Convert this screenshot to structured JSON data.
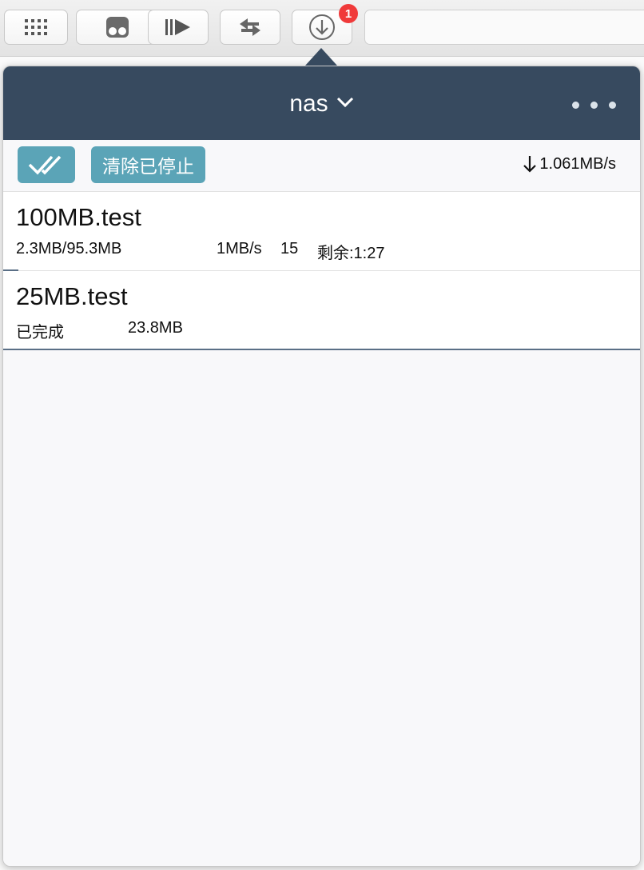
{
  "toolbar": {
    "buttons": [
      {
        "name": "grid-icon"
      },
      {
        "name": "theater-icon"
      },
      {
        "name": "play-next-icon"
      },
      {
        "name": "transfer-icon"
      },
      {
        "name": "download-icon"
      }
    ],
    "download_badge": "1"
  },
  "popover": {
    "host": "nas",
    "clear_stopped_label": "清除已停止",
    "total_speed": "1.061MB/s",
    "colors": {
      "header": "#374a5f",
      "accent": "#5ba4b7",
      "progress": "#5a6f86"
    }
  },
  "downloads": [
    {
      "name": "100MB.test",
      "size": "2.3MB/95.3MB",
      "speed": "1MB/s",
      "connections": "15",
      "remaining": "剩余:1:27",
      "progress": 0.024
    },
    {
      "name": "25MB.test",
      "status": "已完成",
      "size": "23.8MB",
      "progress": 1.0
    }
  ]
}
